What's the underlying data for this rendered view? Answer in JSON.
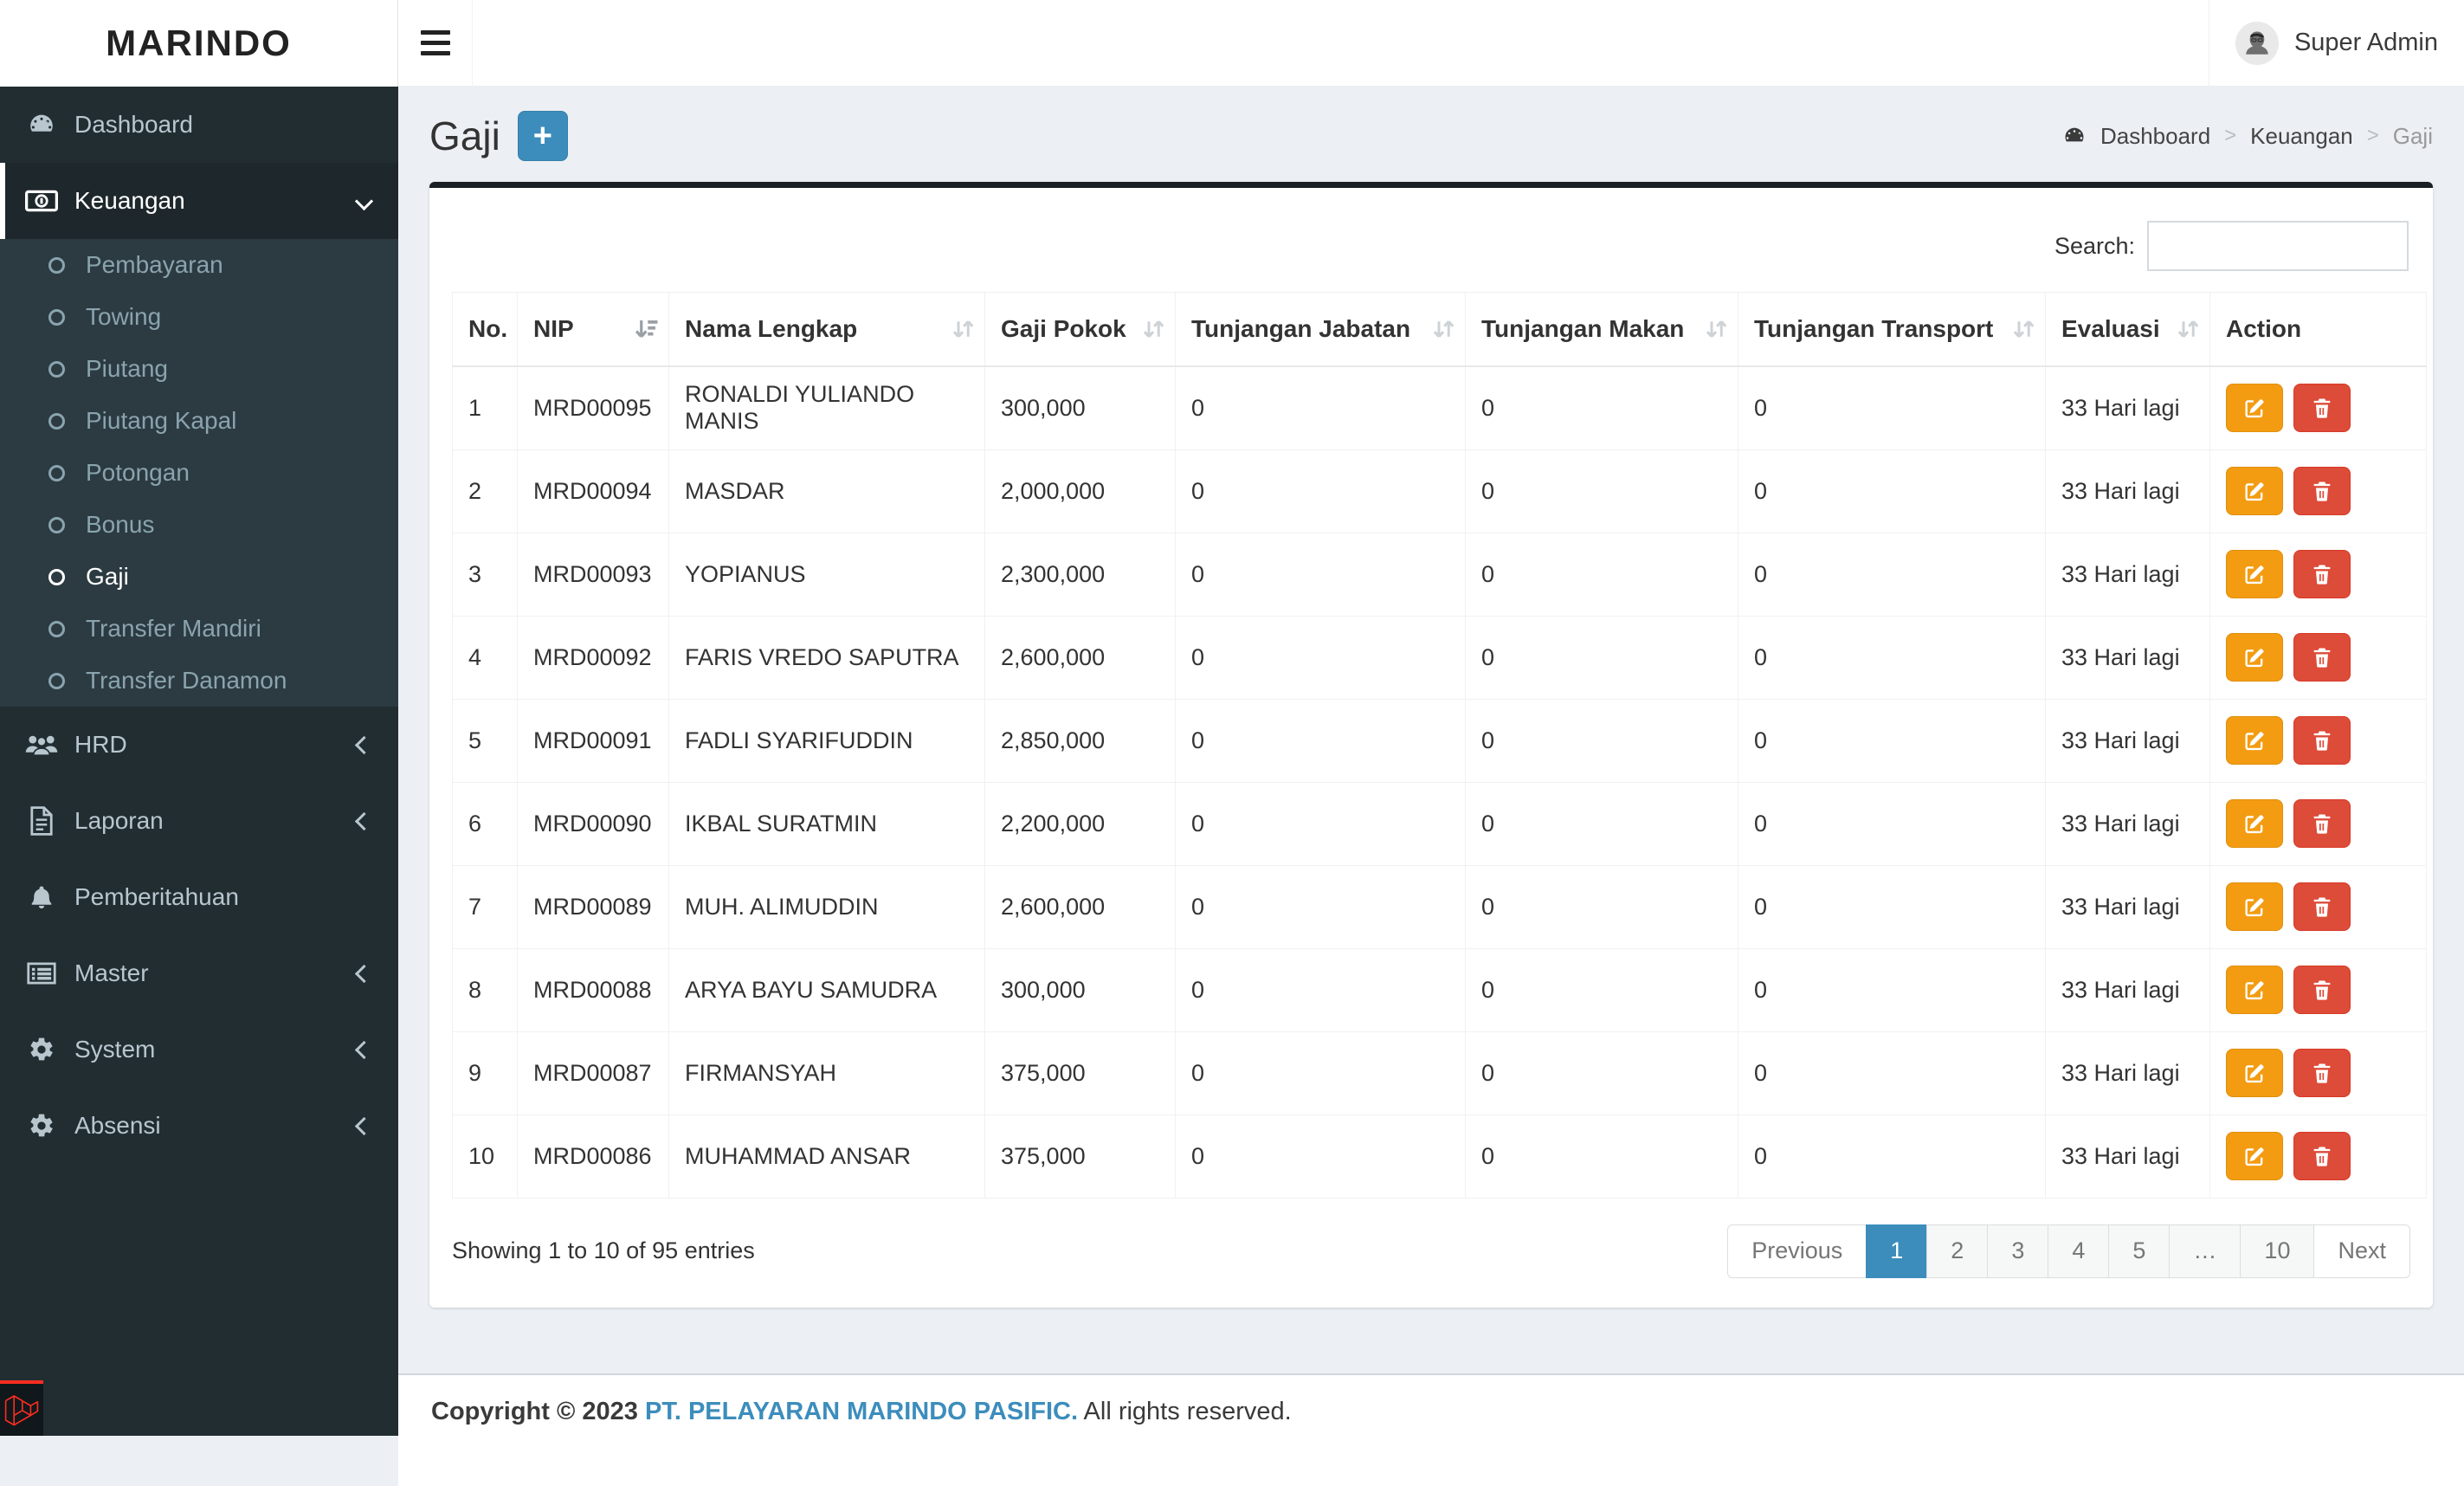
{
  "app": {
    "logo_text": "MARINDO",
    "user_name": "Super Admin"
  },
  "sidebar": {
    "items": [
      {
        "label": "Dashboard"
      },
      {
        "label": "Keuangan"
      },
      {
        "label": "HRD"
      },
      {
        "label": "Laporan"
      },
      {
        "label": "Pemberitahuan"
      },
      {
        "label": "Master"
      },
      {
        "label": "System"
      },
      {
        "label": "Absensi"
      }
    ],
    "keuangan_children": [
      {
        "label": "Pembayaran"
      },
      {
        "label": "Towing"
      },
      {
        "label": "Piutang"
      },
      {
        "label": "Piutang Kapal"
      },
      {
        "label": "Potongan"
      },
      {
        "label": "Bonus"
      },
      {
        "label": "Gaji"
      },
      {
        "label": "Transfer Mandiri"
      },
      {
        "label": "Transfer Danamon"
      }
    ],
    "active_item": "Keuangan",
    "active_child": "Gaji"
  },
  "header": {
    "title": "Gaji",
    "add_button_label": "+"
  },
  "breadcrumb": {
    "home": "Dashboard",
    "section": "Keuangan",
    "current": "Gaji"
  },
  "panel": {
    "search_label": "Search:",
    "search_value": "",
    "columns": [
      "No.",
      "NIP",
      "Nama Lengkap",
      "Gaji Pokok",
      "Tunjangan Jabatan",
      "Tunjangan Makan",
      "Tunjangan Transport",
      "Evaluasi",
      "Action"
    ],
    "sorted_column": "NIP",
    "sort_direction": "desc",
    "rows": [
      {
        "no": "1",
        "nip": "MRD00095",
        "nama": "RONALDI YULIANDO MANIS",
        "gaji_pokok": "300,000",
        "tunjangan_jabatan": "0",
        "tunjangan_makan": "0",
        "tunjangan_transport": "0",
        "evaluasi": "33 Hari lagi"
      },
      {
        "no": "2",
        "nip": "MRD00094",
        "nama": "MASDAR",
        "gaji_pokok": "2,000,000",
        "tunjangan_jabatan": "0",
        "tunjangan_makan": "0",
        "tunjangan_transport": "0",
        "evaluasi": "33 Hari lagi"
      },
      {
        "no": "3",
        "nip": "MRD00093",
        "nama": "YOPIANUS",
        "gaji_pokok": "2,300,000",
        "tunjangan_jabatan": "0",
        "tunjangan_makan": "0",
        "tunjangan_transport": "0",
        "evaluasi": "33 Hari lagi"
      },
      {
        "no": "4",
        "nip": "MRD00092",
        "nama": "FARIS VREDO SAPUTRA",
        "gaji_pokok": "2,600,000",
        "tunjangan_jabatan": "0",
        "tunjangan_makan": "0",
        "tunjangan_transport": "0",
        "evaluasi": "33 Hari lagi"
      },
      {
        "no": "5",
        "nip": "MRD00091",
        "nama": "FADLI SYARIFUDDIN",
        "gaji_pokok": "2,850,000",
        "tunjangan_jabatan": "0",
        "tunjangan_makan": "0",
        "tunjangan_transport": "0",
        "evaluasi": "33 Hari lagi"
      },
      {
        "no": "6",
        "nip": "MRD00090",
        "nama": "IKBAL SURATMIN",
        "gaji_pokok": "2,200,000",
        "tunjangan_jabatan": "0",
        "tunjangan_makan": "0",
        "tunjangan_transport": "0",
        "evaluasi": "33 Hari lagi"
      },
      {
        "no": "7",
        "nip": "MRD00089",
        "nama": "MUH. ALIMUDDIN",
        "gaji_pokok": "2,600,000",
        "tunjangan_jabatan": "0",
        "tunjangan_makan": "0",
        "tunjangan_transport": "0",
        "evaluasi": "33 Hari lagi"
      },
      {
        "no": "8",
        "nip": "MRD00088",
        "nama": "ARYA BAYU SAMUDRA",
        "gaji_pokok": "300,000",
        "tunjangan_jabatan": "0",
        "tunjangan_makan": "0",
        "tunjangan_transport": "0",
        "evaluasi": "33 Hari lagi"
      },
      {
        "no": "9",
        "nip": "MRD00087",
        "nama": "FIRMANSYAH",
        "gaji_pokok": "375,000",
        "tunjangan_jabatan": "0",
        "tunjangan_makan": "0",
        "tunjangan_transport": "0",
        "evaluasi": "33 Hari lagi"
      },
      {
        "no": "10",
        "nip": "MRD00086",
        "nama": "MUHAMMAD ANSAR",
        "gaji_pokok": "375,000",
        "tunjangan_jabatan": "0",
        "tunjangan_makan": "0",
        "tunjangan_transport": "0",
        "evaluasi": "33 Hari lagi"
      }
    ],
    "info": "Showing 1 to 10 of 95 entries",
    "pagination": {
      "previous": "Previous",
      "pages": [
        "1",
        "2",
        "3",
        "4",
        "5",
        "…",
        "10"
      ],
      "next": "Next",
      "active_page": "1"
    }
  },
  "footer": {
    "copyright_bold": "Copyright © 2023",
    "company_link": "PT. PELAYARAN MARINDO PASIFIC.",
    "rights": "All rights reserved."
  },
  "colors": {
    "accent": "#3c8dbc",
    "warning_button": "#f39c12",
    "danger_button": "#dd4b39",
    "sidebar_bg": "#222d32",
    "submenu_bg": "#2c3b41",
    "body_bg": "#ecf0f5",
    "laravel_red": "#ff2d20"
  }
}
